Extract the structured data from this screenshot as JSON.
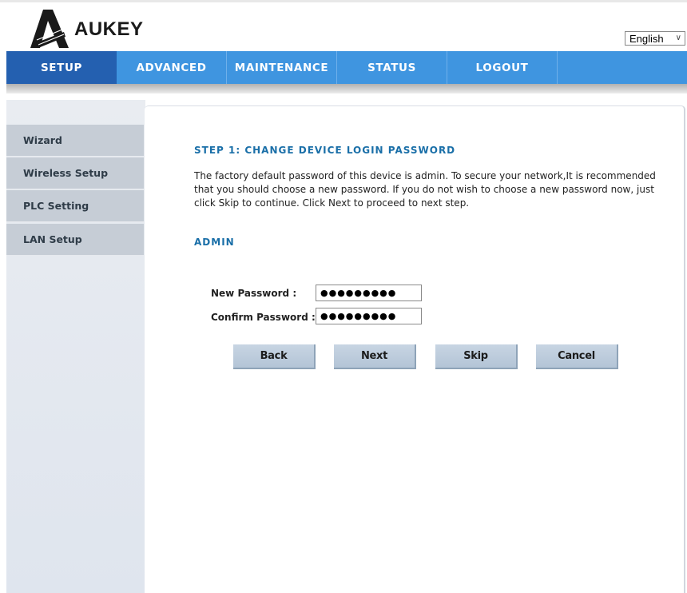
{
  "brand": {
    "name": "AUKEY"
  },
  "language": {
    "selected": "English"
  },
  "nav": {
    "items": [
      {
        "label": "SETUP",
        "active": true
      },
      {
        "label": "ADVANCED",
        "active": false
      },
      {
        "label": "MAINTENANCE",
        "active": false
      },
      {
        "label": "STATUS",
        "active": false
      },
      {
        "label": "LOGOUT",
        "active": false
      }
    ]
  },
  "sidebar": {
    "items": [
      {
        "label": "Wizard"
      },
      {
        "label": "Wireless Setup"
      },
      {
        "label": "PLC Setting"
      },
      {
        "label": "LAN Setup"
      }
    ]
  },
  "main": {
    "step_title": "STEP 1: CHANGE DEVICE LOGIN PASSWORD",
    "description": "The factory default password of this device is admin. To secure your network,It is recommended that you should choose a new password. If you do not wish to choose a new password now, just click Skip to continue. Click Next to proceed to next step.",
    "section_title": "ADMIN",
    "fields": {
      "new_password": {
        "label": "New Password :",
        "value": "●●●●●●●●●"
      },
      "confirm_password": {
        "label": "Confirm Password :",
        "value": "●●●●●●●●●"
      }
    },
    "buttons": {
      "back": "Back",
      "next": "Next",
      "skip": "Skip",
      "cancel": "Cancel"
    }
  },
  "colors": {
    "nav_bg": "#3f95e0",
    "nav_active": "#2460b0",
    "title_blue": "#1a6fa8",
    "sidebar_item": "#c6cdd6"
  }
}
